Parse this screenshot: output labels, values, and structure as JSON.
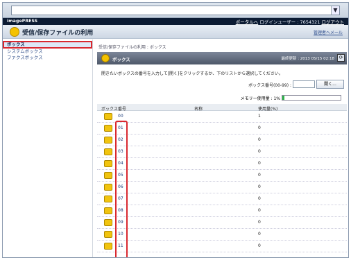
{
  "browser": {
    "address_dropdown_glyph": "▼"
  },
  "topbar": {
    "logo": "imagePRESS",
    "portal_link": "ポータルへ",
    "login_user": "ログインユーザー : 7654321",
    "logout": "ログアウト"
  },
  "title": {
    "text": "受信/保存ファイルの利用",
    "manager_link": "管理者へメール"
  },
  "sidebar": {
    "items": [
      {
        "label": "ボックス"
      },
      {
        "label": "システムボックス"
      },
      {
        "label": "ファクスボックス"
      }
    ]
  },
  "main": {
    "breadcrumb": "受信/保存ファイルの利用 : ボックス",
    "header_title": "ボックス",
    "last_update": "最終更新 : 2013 05/15 02:18",
    "refresh_glyph": "⟳",
    "instruction": "開きたいボックスの番号を入力して[開く]をクリックするか、下のリストから選択してください。",
    "box_number_label": "ボックス番号(00-99) :",
    "box_number_value": "",
    "open_button": "開く...",
    "memory_label": "メモリー使用量 : 1%",
    "memory_percent": 1,
    "columns": {
      "number": "ボックス番号",
      "name": "名称",
      "used": "使用量(%)"
    },
    "rows": [
      {
        "num": "00",
        "name": "",
        "used": "1"
      },
      {
        "num": "01",
        "name": "",
        "used": "0"
      },
      {
        "num": "02",
        "name": "",
        "used": "0"
      },
      {
        "num": "03",
        "name": "",
        "used": "0"
      },
      {
        "num": "04",
        "name": "",
        "used": "0"
      },
      {
        "num": "05",
        "name": "",
        "used": "0"
      },
      {
        "num": "06",
        "name": "",
        "used": "0"
      },
      {
        "num": "07",
        "name": "",
        "used": "0"
      },
      {
        "num": "08",
        "name": "",
        "used": "0"
      },
      {
        "num": "09",
        "name": "",
        "used": "0"
      },
      {
        "num": "10",
        "name": "",
        "used": "0"
      },
      {
        "num": "11",
        "name": "",
        "used": "0"
      }
    ]
  },
  "colors": {
    "accent": "#d9282f",
    "topbar": "#0c1b33",
    "folder": "#f1c40f",
    "memory": "#2fb34a"
  }
}
